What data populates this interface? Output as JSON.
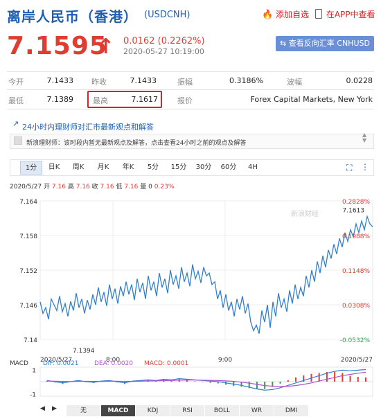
{
  "header": {
    "title": "离岸人民币（香港）",
    "code": "(USDCNH)",
    "add_watch": "添加自选",
    "app_view": "在APP中查看"
  },
  "quote": {
    "price": "7.1595",
    "arrow": "↑",
    "change": "0.0162 (0.2262%)",
    "time": "2020-05-27 10:19:00",
    "reverse_button": "查看反向汇率 CNHUSD"
  },
  "stats": {
    "open_label": "今开",
    "open": "7.1433",
    "prev_label": "昨收",
    "prev": "7.1433",
    "amp_label": "振幅",
    "amp": "0.3186%",
    "wave_label": "波幅",
    "wave": "0.0228",
    "low_label": "最低",
    "low": "7.1389",
    "high_label": "最高",
    "high": "7.1617",
    "quoter_label": "报价",
    "quoter": "Forex Capital Markets, New York"
  },
  "news": {
    "heading": "24小时内理财师对汇市最新观点和解答",
    "text": "新浪理财师：该时段内暂无最新观点及解答，点击查看24小时之前的观点及解答"
  },
  "tabs": [
    "1分",
    "日K",
    "周K",
    "月K",
    "年K",
    "5分",
    "15分",
    "30分",
    "60分",
    "4H"
  ],
  "active_tab": "1分",
  "chart_info": {
    "date": "2020/5/27",
    "open_label": "开",
    "open": "7.16",
    "high_label": "高",
    "high": "7.16",
    "close_label": "收",
    "close": "7.16",
    "low_label": "低",
    "low": "7.16",
    "vol_label": "量",
    "vol": "0",
    "pct": "0.23%"
  },
  "chart_data": {
    "type": "line",
    "ylim": [
      7.14,
      7.164
    ],
    "y_ticks": [
      "7.164",
      "7.158",
      "7.152",
      "7.146",
      "7.14"
    ],
    "pct_ticks": [
      "0.2828%",
      "0.1988%",
      "0.1148%",
      "0.0308%",
      "-0.0532%"
    ],
    "x_ticks": [
      "8:00",
      "9:00"
    ],
    "x_start": "2020/5/27",
    "x_end": "2020/5/27",
    "low_marker": "7.1394",
    "high_marker": "7.1613",
    "watermark": "新浪财经",
    "series": [
      {
        "values": [
          7.1465,
          7.1445,
          7.1455,
          7.1435,
          7.147,
          7.146,
          7.145,
          7.1475,
          7.1448,
          7.1462,
          7.144,
          7.1466,
          7.145,
          7.148,
          7.1455,
          7.147,
          7.1445,
          7.1468,
          7.1452,
          7.1478,
          7.146,
          7.149,
          7.1465,
          7.1482,
          7.1458,
          7.1495,
          7.147,
          7.1488,
          7.1462,
          7.1492,
          7.1475,
          7.15,
          7.1478,
          7.1495,
          7.1468,
          7.1505,
          7.1482,
          7.1498,
          7.147,
          7.151,
          7.1485,
          7.15,
          7.1475,
          7.1515,
          7.149,
          7.1505,
          7.148,
          7.152,
          7.1495,
          7.151,
          7.1488,
          7.1525,
          7.15,
          7.1515,
          7.1492,
          7.153,
          7.1505,
          7.1518,
          7.1498,
          7.1525,
          7.151,
          7.1515,
          7.1495,
          7.15,
          7.147,
          7.1485,
          7.1455,
          7.1478,
          7.145,
          7.1465,
          7.144,
          7.147,
          7.1452,
          7.1475,
          7.1445,
          7.1462,
          7.143,
          7.1415,
          7.1425,
          7.141,
          7.145,
          7.143,
          7.146,
          7.142,
          7.1465,
          7.144,
          7.148,
          7.1455,
          7.147,
          7.1448,
          7.1485,
          7.1462,
          7.1495,
          7.147,
          7.149,
          7.1475,
          7.151,
          7.149,
          7.152,
          7.15,
          7.1535,
          7.1515,
          7.1545,
          7.1525,
          7.1555,
          7.154,
          7.1565,
          7.1548,
          7.1575,
          7.156,
          7.1585,
          7.157,
          7.159,
          7.1578,
          7.16,
          7.1585,
          7.1605,
          7.159,
          7.1613,
          7.16,
          7.1595
        ]
      }
    ],
    "macd": {
      "label": "MACD",
      "dif_label": "DIF:",
      "dif": "0.0021",
      "dea_label": "DEA:",
      "dea": "0.0020",
      "macd_label": "MACD:",
      "macd": "0.0001",
      "ylim": [
        -1.2,
        1.2
      ],
      "y_ticks": [
        "1",
        "-1"
      ],
      "dif_values": [
        0.1,
        0.0,
        -0.1,
        0.0,
        0.1,
        0.0,
        -0.05,
        0.05,
        0.1,
        0.0,
        -0.1,
        0.05,
        0.1,
        0.15,
        0.1,
        0.2,
        0.15,
        0.25,
        0.2,
        0.15,
        0.1,
        0.05,
        0.0,
        -0.1,
        -0.2,
        -0.3,
        -0.45,
        -0.6,
        -0.7,
        -0.65,
        -0.5,
        -0.3,
        -0.1,
        0.1,
        0.3,
        0.5,
        0.7,
        0.85,
        0.95,
        0.9,
        0.95,
        1.0
      ],
      "dea_values": [
        0.05,
        0.04,
        0.02,
        0.01,
        0.03,
        0.03,
        0.02,
        0.02,
        0.04,
        0.04,
        0.02,
        0.02,
        0.04,
        0.06,
        0.07,
        0.09,
        0.1,
        0.12,
        0.13,
        0.13,
        0.12,
        0.11,
        0.09,
        0.06,
        0.02,
        -0.04,
        -0.12,
        -0.22,
        -0.32,
        -0.38,
        -0.4,
        -0.38,
        -0.32,
        -0.22,
        -0.1,
        0.05,
        0.2,
        0.35,
        0.5,
        0.6,
        0.7,
        0.78
      ]
    }
  },
  "bottom_tabs": [
    "无",
    "MACD",
    "KDJ",
    "RSI",
    "BOLL",
    "WR",
    "DMI"
  ],
  "bottom_active": "MACD",
  "colors": {
    "up": "#e03c32",
    "down": "#2e9e4f",
    "line": "#2f7fd1",
    "accent": "#1e5fb3"
  }
}
